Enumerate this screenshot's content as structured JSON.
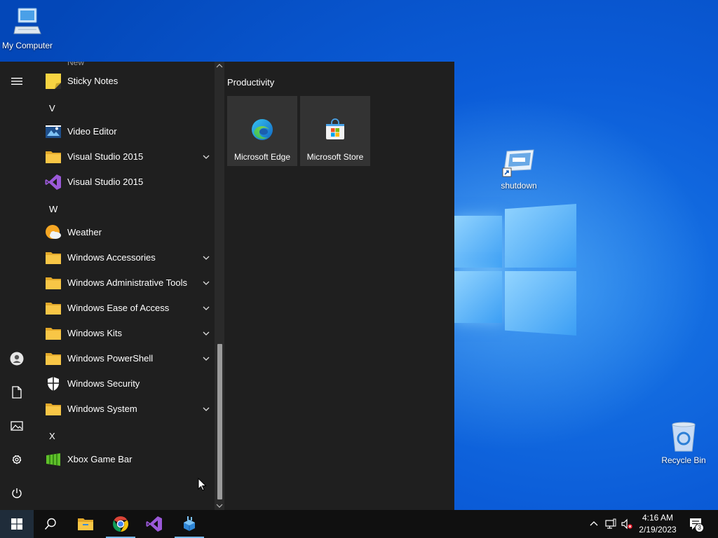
{
  "desktop": {
    "icons": [
      {
        "label": "My Computer",
        "icon": "computer-icon"
      },
      {
        "label": "shutdown",
        "icon": "shortcut-icon"
      },
      {
        "label": "Recycle Bin",
        "icon": "recycle-bin-icon"
      }
    ]
  },
  "start_menu": {
    "partial_top_text": "New",
    "items": [
      {
        "type": "app",
        "label": "Sticky Notes",
        "icon": "sticky-notes-icon"
      },
      {
        "type": "letter",
        "label": "V"
      },
      {
        "type": "app",
        "label": "Video Editor",
        "icon": "video-editor-icon"
      },
      {
        "type": "folder",
        "label": "Visual Studio 2015",
        "icon": "folder-icon",
        "expandable": true
      },
      {
        "type": "app",
        "label": "Visual Studio 2015",
        "icon": "visual-studio-icon"
      },
      {
        "type": "letter",
        "label": "W"
      },
      {
        "type": "app",
        "label": "Weather",
        "icon": "weather-icon"
      },
      {
        "type": "folder",
        "label": "Windows Accessories",
        "icon": "folder-icon",
        "expandable": true
      },
      {
        "type": "folder",
        "label": "Windows Administrative Tools",
        "icon": "folder-icon",
        "expandable": true
      },
      {
        "type": "folder",
        "label": "Windows Ease of Access",
        "icon": "folder-icon",
        "expandable": true
      },
      {
        "type": "folder",
        "label": "Windows Kits",
        "icon": "folder-icon",
        "expandable": true
      },
      {
        "type": "folder",
        "label": "Windows PowerShell",
        "icon": "folder-icon",
        "expandable": true
      },
      {
        "type": "app",
        "label": "Windows Security",
        "icon": "shield-icon"
      },
      {
        "type": "folder",
        "label": "Windows System",
        "icon": "folder-icon",
        "expandable": true
      },
      {
        "type": "letter",
        "label": "X"
      },
      {
        "type": "app",
        "label": "Xbox Game Bar",
        "icon": "xbox-game-bar-icon"
      }
    ],
    "rail": [
      "hamburger-icon",
      "user-icon",
      "documents-icon",
      "pictures-icon",
      "settings-icon",
      "power-icon"
    ],
    "tiles_group": "Productivity",
    "tiles": [
      {
        "label": "Microsoft Edge",
        "icon": "edge-icon"
      },
      {
        "label": "Microsoft Store",
        "icon": "store-icon"
      }
    ]
  },
  "taskbar": {
    "buttons": [
      "start-icon",
      "search-icon",
      "file-explorer-icon",
      "chrome-icon",
      "visual-studio-icon",
      "app-icon"
    ],
    "clock": {
      "time": "4:16 AM",
      "date": "2/19/2023"
    },
    "notification_count": "3"
  },
  "colors": {
    "menu_bg": "#1f1f1f",
    "tile_bg": "#333333",
    "taskbar_bg": "#101010",
    "accent": "#76b9ed",
    "folder": "#f8c646"
  }
}
